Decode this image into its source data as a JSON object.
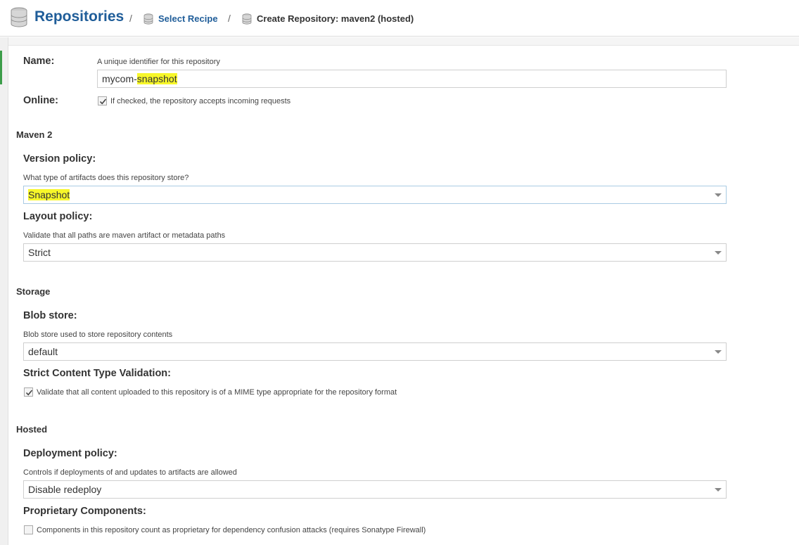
{
  "header": {
    "title": "Repositories",
    "separator": "/",
    "crumb_select_recipe": "Select Recipe",
    "crumb_current": "Create Repository: maven2 (hosted)"
  },
  "name": {
    "label": "Name:",
    "help": "A unique identifier for this repository",
    "value_prefix": "mycom-",
    "value_highlight": "snapshot"
  },
  "online": {
    "label": "Online:",
    "checked": true,
    "text": "If checked, the repository accepts incoming requests"
  },
  "maven2": {
    "section": "Maven 2",
    "version_policy_label": "Version policy:",
    "version_policy_help": "What type of artifacts does this repository store?",
    "version_policy_value": "Snapshot",
    "layout_policy_label": "Layout policy:",
    "layout_policy_help": "Validate that all paths are maven artifact or metadata paths",
    "layout_policy_value": "Strict"
  },
  "storage": {
    "section": "Storage",
    "blob_store_label": "Blob store:",
    "blob_store_help": "Blob store used to store repository contents",
    "blob_store_value": "default",
    "strict_label": "Strict Content Type Validation:",
    "strict_checked": true,
    "strict_text": "Validate that all content uploaded to this repository is of a MIME type appropriate for the repository format"
  },
  "hosted": {
    "section": "Hosted",
    "deployment_label": "Deployment policy:",
    "deployment_help": "Controls if deployments of and updates to artifacts are allowed",
    "deployment_value": "Disable redeploy",
    "proprietary_label": "Proprietary Components:",
    "proprietary_checked": false,
    "proprietary_text": "Components in this repository count as proprietary for dependency confusion attacks (requires Sonatype Firewall)"
  },
  "colors": {
    "link": "#1f5d99",
    "highlight": "#f7f72a",
    "active_strip": "#3c9d4a"
  },
  "icons": {
    "header": "database-icon",
    "crumb": "database-icon",
    "dropdown": "caret-down-icon",
    "check": "checkmark-icon"
  }
}
